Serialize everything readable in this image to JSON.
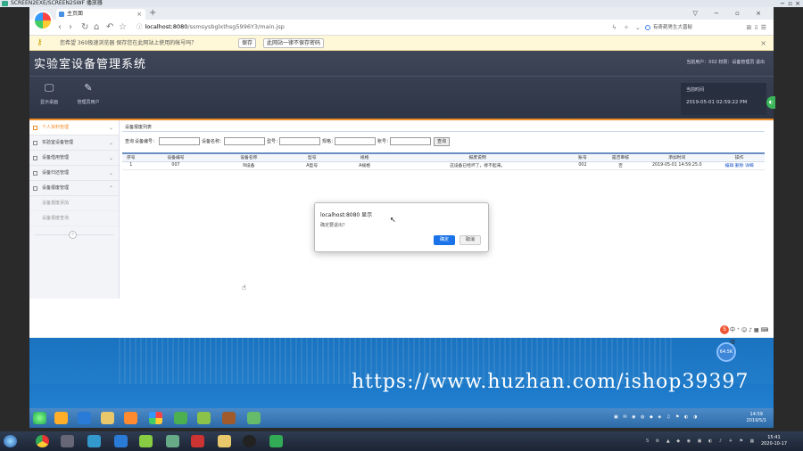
{
  "player": {
    "title": "SCREEN2EXE/SCREEN2SWF 播放器"
  },
  "browser": {
    "tab_title": "主页面",
    "tab_new": "+",
    "tab_close": "×",
    "url_host": "localhost:8080",
    "url_path": "/ssmsysbglxthsg5996Y3/main.jsp",
    "search_hint": "有奇葩男生大晋秘",
    "window_controls": "▽ − ▫ ×",
    "password_bar": {
      "message": "您希望 360极速浏览器 保存您在此网站上使用的帐号吗？",
      "save_label": "保存",
      "never_label": "此网站一律不保存密码",
      "close": "×"
    }
  },
  "app": {
    "title": "实验室设备管理系统",
    "user_info": "当前用户：002 权限：设备管理员  退出",
    "nav": [
      {
        "label": "显示桌面"
      },
      {
        "label": "管理员用户"
      }
    ],
    "time_label": "当前时间",
    "time_value": "2019-05-01 02:59:22 PM",
    "sidebar": {
      "items": [
        {
          "label": "个人资料管理",
          "active": true
        },
        {
          "label": "实验室设备管理",
          "active": false
        },
        {
          "label": "设备借用管理",
          "active": false
        },
        {
          "label": "设备归还管理",
          "active": false
        },
        {
          "label": "设备报废管理",
          "active": false
        }
      ],
      "subitems": [
        {
          "label": "设备报废添加"
        },
        {
          "label": "设备报废查询"
        }
      ]
    },
    "panel_title": "设备报废列表",
    "search": {
      "prefix": "查询",
      "fields": [
        {
          "label": "设备编号："
        },
        {
          "label": "设备名称："
        },
        {
          "label": "型号："
        },
        {
          "label": "规格："
        },
        {
          "label": "账号："
        }
      ],
      "button": "查询"
    },
    "table": {
      "headers": [
        "序号",
        "设备编号",
        "设备名称",
        "型号",
        "规格",
        "报废说明",
        "账号",
        "是否审核",
        "添加时间",
        "操作"
      ],
      "rows": [
        [
          "1",
          "007",
          "N设备",
          "A型号",
          "A规格",
          "这设备已经坏了，修不起来。",
          "002",
          "否",
          "2019-05-01 14:59:25.0"
        ]
      ],
      "ops": [
        "编辑",
        "删除",
        "详细"
      ]
    },
    "dialog": {
      "title": "localhost:8080 显示",
      "message": "确定要退出？",
      "ok": "确定",
      "cancel": "取消"
    }
  },
  "watermark": "https://www.huzhan.com/ishop39397",
  "ime": {
    "badge": "S",
    "text": "中 ⁺ ☺ ♪ ▦ ⌨ ▥"
  },
  "float_ball": "64.5K",
  "inner_clock": {
    "time": "14:59",
    "date": "2019/5/1"
  },
  "outer_clock": {
    "time": "15:41",
    "date": "2020-10-17"
  },
  "colors": {
    "accent": "#f08c28",
    "header": "#2e3546",
    "link": "#1a56c8",
    "primary_button": "#1a73e8"
  }
}
